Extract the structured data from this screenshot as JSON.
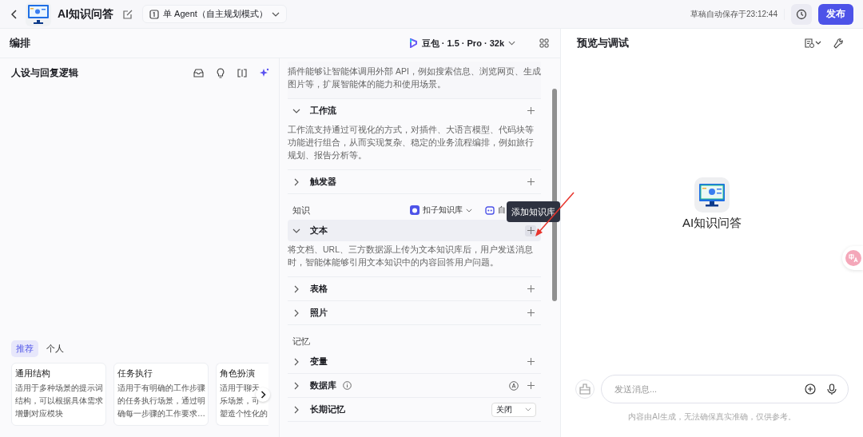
{
  "header": {
    "title": "AI知识问答",
    "mode": "单 Agent（自主规划模式）",
    "autosave": "草稿自动保存于23:12:44",
    "publish": "发布"
  },
  "editor": {
    "title": "编排",
    "model": "豆包 · 1.5 · Pro · 32k"
  },
  "persona": {
    "title": "人设与回复逻辑",
    "template_tabs": [
      {
        "label": "推荐",
        "selected": true
      },
      {
        "label": "个人",
        "selected": false
      }
    ],
    "templates": [
      {
        "title": "通用结构",
        "lines": [
          "适用于多种场景的提示词",
          "结构，可以根据具体需求",
          "增删对应模块"
        ]
      },
      {
        "title": "任务执行",
        "lines": [
          "适用于有明确的工作步骤",
          "的任务执行场景，通过明",
          "确每一步骤的工作要求…"
        ]
      },
      {
        "title": "角色扮演",
        "lines": [
          "适用于聊天",
          "乐场景，可",
          "塑造个性化的"
        ]
      }
    ]
  },
  "skills": [
    {
      "kind": "desc",
      "text": "插件能够让智能体调用外部 API，例如搜索信息、浏览网页、生成图片等，扩展智能体的能力和使用场景。"
    },
    {
      "kind": "section",
      "title": "工作流",
      "expanded": true,
      "hovered": false,
      "has_add": true,
      "description": "工作流支持通过可视化的方式，对插件、大语言模型、代码块等功能进行组合，从而实现复杂、稳定的业务流程编排，例如旅行规划、报告分析等。"
    },
    {
      "kind": "section",
      "title": "触发器",
      "expanded": false,
      "hovered": false,
      "has_add": true
    },
    {
      "kind": "group",
      "label": "知识",
      "source": "扣子知识库",
      "extra": "自"
    },
    {
      "kind": "section",
      "title": "文本",
      "expanded": true,
      "hovered": true,
      "has_add": true,
      "description": "将文档、URL、三方数据源上传为文本知识库后，用户发送消息时，智能体能够引用文本知识中的内容回答用户问题。"
    },
    {
      "kind": "section",
      "title": "表格",
      "expanded": false,
      "hovered": false,
      "has_add": true
    },
    {
      "kind": "section",
      "title": "照片",
      "expanded": false,
      "hovered": false,
      "has_add": true
    },
    {
      "kind": "group",
      "label": "记忆"
    },
    {
      "kind": "section",
      "title": "变量",
      "expanded": false,
      "hovered": false,
      "has_add": true
    },
    {
      "kind": "section",
      "title": "数据库",
      "expanded": false,
      "hovered": false,
      "has_add": true,
      "info": true,
      "auto": true
    },
    {
      "kind": "section",
      "title": "长期记忆",
      "expanded": false,
      "hovered": false,
      "has_add": false,
      "select_value": "关闭"
    }
  ],
  "tooltip": "添加知识库",
  "preview": {
    "title": "预览与调试",
    "agent_name": "AI知识问答",
    "input": {
      "placeholder": "发送消息..."
    },
    "disclaimer": "内容由AI生成，无法确保真实准确，仅供参考。"
  }
}
